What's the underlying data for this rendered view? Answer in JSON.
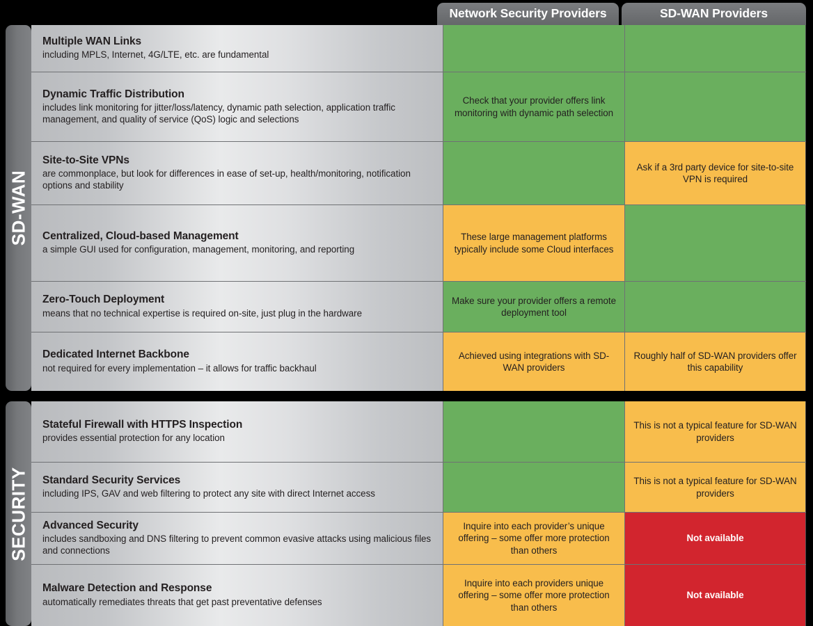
{
  "columns": {
    "network_security_providers": "Network Security Providers",
    "sdwan_providers": "SD-WAN Providers"
  },
  "sections": [
    {
      "label": "SD-WAN",
      "rows": [
        {
          "title": "Multiple WAN Links",
          "subtitle": "including MPLS, Internet, 4G/LTE, etc. are fundamental",
          "nsp": {
            "status": "green",
            "text": ""
          },
          "sdwan": {
            "status": "green",
            "text": ""
          }
        },
        {
          "title": "Dynamic Traffic Distribution",
          "subtitle": "includes link monitoring for jitter/loss/latency, dynamic path selection, application traffic management, and quality of service (QoS) logic and selections",
          "nsp": {
            "status": "green",
            "text": "Check that your provider offers link monitoring with dynamic path selection"
          },
          "sdwan": {
            "status": "green",
            "text": ""
          }
        },
        {
          "title": "Site-to-Site VPNs",
          "subtitle": "are commonplace, but look for differences in ease of set-up, health/monitoring, notification options and stability",
          "nsp": {
            "status": "green",
            "text": ""
          },
          "sdwan": {
            "status": "orange",
            "text": "Ask if a 3rd party device for site-to-site VPN is required"
          }
        },
        {
          "title": "Centralized, Cloud-based Management",
          "subtitle": "a simple GUI used for configuration, management, monitoring, and reporting",
          "nsp": {
            "status": "orange",
            "text": "These large management platforms typically include some Cloud interfaces"
          },
          "sdwan": {
            "status": "green",
            "text": ""
          }
        },
        {
          "title": "Zero-Touch Deployment",
          "subtitle": "means that no technical expertise is required on-site, just plug in the hardware",
          "nsp": {
            "status": "green",
            "text": "Make sure your provider offers a remote deployment tool"
          },
          "sdwan": {
            "status": "green",
            "text": ""
          }
        },
        {
          "title": "Dedicated Internet Backbone",
          "subtitle": "not required for every implementation – it allows for traffic backhaul",
          "nsp": {
            "status": "orange",
            "text": "Achieved using integrations with SD-WAN providers"
          },
          "sdwan": {
            "status": "orange",
            "text": "Roughly half of SD-WAN providers offer this capability"
          }
        }
      ]
    },
    {
      "label": "SECURITY",
      "rows": [
        {
          "title": "Stateful Firewall with HTTPS Inspection",
          "subtitle": "provides essential protection for any location",
          "nsp": {
            "status": "green",
            "text": ""
          },
          "sdwan": {
            "status": "orange",
            "text": "This is not a typical feature for SD-WAN providers"
          }
        },
        {
          "title": "Standard Security Services",
          "subtitle": "including IPS, GAV and web filtering to protect any site with direct Internet access",
          "nsp": {
            "status": "green",
            "text": ""
          },
          "sdwan": {
            "status": "orange",
            "text": "This is not a typical feature for SD-WAN providers"
          }
        },
        {
          "title": "Advanced Security",
          "subtitle": "includes sandboxing and DNS filtering to prevent common evasive attacks using malicious files and connections",
          "nsp": {
            "status": "orange",
            "text": "Inquire into each provider’s unique offering – some offer more protection than others"
          },
          "sdwan": {
            "status": "red",
            "text": "Not available"
          }
        },
        {
          "title": "Malware Detection and Response",
          "subtitle": "automatically remediates threats that get past preventative defenses",
          "nsp": {
            "status": "orange",
            "text": "Inquire into each providers unique offering – some offer more protection than others"
          },
          "sdwan": {
            "status": "red",
            "text": "Not available"
          }
        }
      ]
    }
  ],
  "colors": {
    "available": "#6aaf5e",
    "partial": "#f8bd4c",
    "unavailable": "#d2252e",
    "header_gray": "#6e7073",
    "background": "#000000"
  }
}
